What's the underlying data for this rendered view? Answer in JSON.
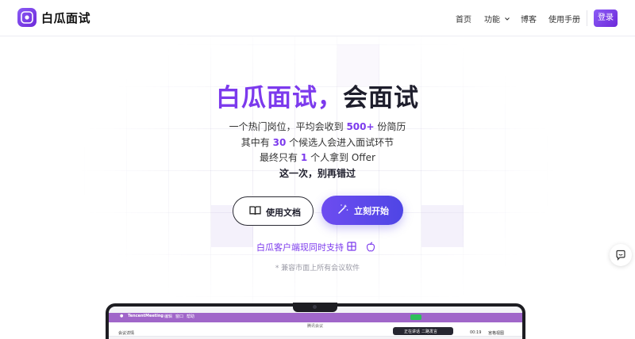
{
  "header": {
    "brand": "白瓜面试",
    "nav": {
      "home": "首页",
      "features": "功能",
      "blog": "博客",
      "manual": "使用手册"
    },
    "login": "登录"
  },
  "hero": {
    "title_accent": "白瓜面试，",
    "title_plain": "会面试",
    "line1_pre": "一个热门岗位，平均会收到",
    "line1_num": "500+",
    "line1_post": "份简历",
    "line2_pre": "其中有",
    "line2_num": "30",
    "line2_post": "个候选人会进入面试环节",
    "line3_pre": "最终只有",
    "line3_num": "1",
    "line3_post": "个人拿到 Offer",
    "line4": "这一次，别再错过"
  },
  "buttons": {
    "docs": "使用文档",
    "start": "立刻开始"
  },
  "client_support": "白瓜客户端现同时支持",
  "compat_note": "* 兼容市面上所有会议软件",
  "mockup": {
    "app_name": "TencentMeeting",
    "menu": [
      "编辑",
      "窗口",
      "帮助"
    ],
    "window_title": "腾讯会议",
    "meeting_detail": "会议详情",
    "speaking": "正在讲话",
    "speaker": "二路发言",
    "timer": "00:19",
    "view": "宫格视图"
  },
  "colors": {
    "accent": "#7c3aed",
    "button_gradient_start": "#6d4cf0",
    "button_gradient_end": "#4f46e5",
    "menubar": "#a066c9"
  },
  "icons": {
    "logo": "eye-logo-icon",
    "features_chevron": "chevron-down-icon",
    "docs": "book-icon",
    "start": "magic-wand-icon",
    "windows": "windows-icon",
    "mac": "apple-icon",
    "chat": "chat-bubble-icon"
  }
}
